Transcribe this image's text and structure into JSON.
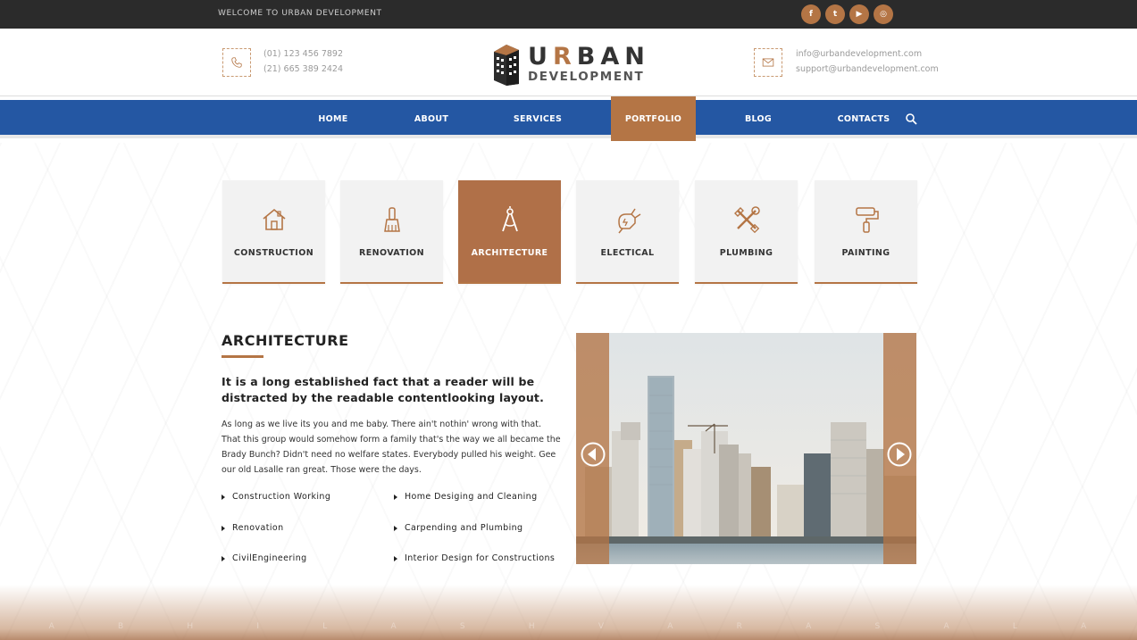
{
  "topbar": {
    "welcome": "WELCOME TO URBAN DEVELOPMENT",
    "social": [
      {
        "icon": "facebook-icon",
        "glyph": "f"
      },
      {
        "icon": "twitter-icon",
        "glyph": "t"
      },
      {
        "icon": "youtube-icon",
        "glyph": "▶"
      },
      {
        "icon": "instagram-icon",
        "glyph": "◎"
      }
    ]
  },
  "header": {
    "phones": [
      "(01) 123 456 7892",
      "(21) 665 389 2424"
    ],
    "emails": [
      "info@urbandevelopment.com",
      "support@urbandevelopment.com"
    ],
    "logo_word1_a": "U",
    "logo_word1_b": "R",
    "logo_word1_c": "BAN",
    "logo_word2": "DEVELOPMENT"
  },
  "nav": {
    "items": [
      "HOME",
      "ABOUT",
      "SERVICES",
      "PORTFOLIO",
      "BLOG",
      "CONTACTS"
    ],
    "active": "PORTFOLIO"
  },
  "services": [
    {
      "label": "CONSTRUCTION",
      "icon": "house-icon"
    },
    {
      "label": "RENOVATION",
      "icon": "paint-brush-icon"
    },
    {
      "label": "ARCHITECTURE",
      "icon": "compass-icon"
    },
    {
      "label": "ELECTICAL",
      "icon": "electric-plug-icon"
    },
    {
      "label": "PLUMBING",
      "icon": "tools-icon"
    },
    {
      "label": "PAINTING",
      "icon": "paint-roller-icon"
    }
  ],
  "content": {
    "title": "ARCHITECTURE",
    "lead": "It is a long established fact that a reader will be distracted by the readable contentlooking layout.",
    "body": "As long as we live its you and me baby. There ain't nothin' wrong with that. That this group would somehow form a family that's the way we all became the Brady Bunch? Didn't need no welfare states. Everybody pulled his weight. Gee our old Lasalle ran great. Those were the days.",
    "features_left": [
      "Construction Working",
      "Renovation",
      "CivilEngineering"
    ],
    "features_right": [
      "Home Desiging and Cleaning",
      "Carpending and Plumbing",
      "Interior Design for Constructions"
    ]
  },
  "footer_letters": [
    "A",
    "B",
    "H",
    "I",
    "L",
    "A",
    "S",
    "H",
    "V",
    "A",
    "R",
    "A",
    "S",
    "A",
    "L",
    "A"
  ],
  "colors": {
    "accent": "#b47545",
    "nav": "#2457a3",
    "topbar": "#2b2b2b"
  }
}
